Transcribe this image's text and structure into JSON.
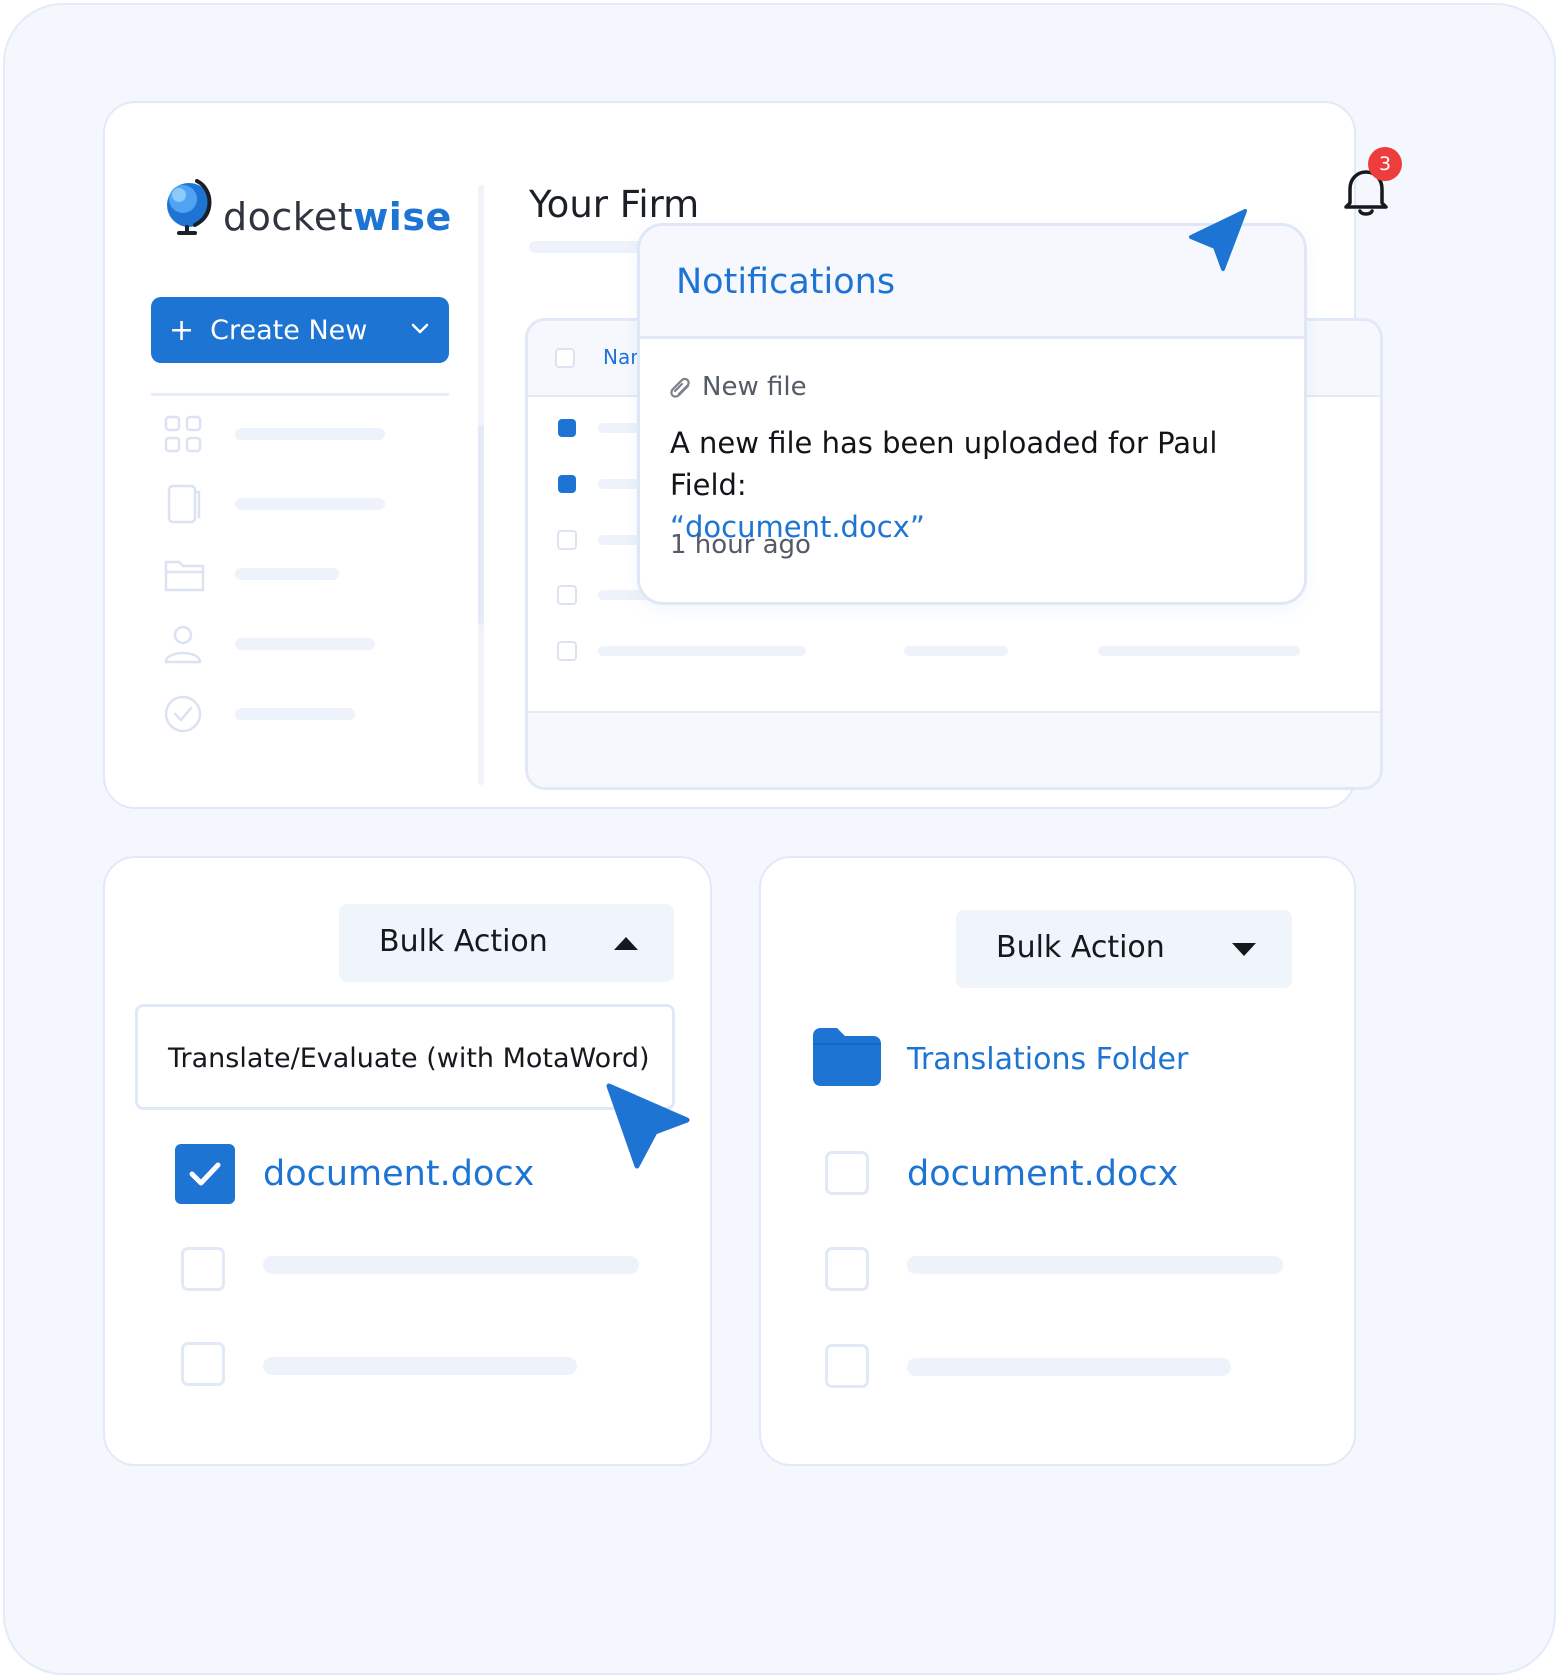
{
  "brand": {
    "logo_prefix": "docket",
    "logo_suffix": "wise"
  },
  "sidebar": {
    "create_button_label": "Create New"
  },
  "header": {
    "page_title": "Your Firm",
    "notification_count": "3"
  },
  "table": {
    "column_name": "Name"
  },
  "notifications": {
    "title": "Notifications",
    "item_type": "New file",
    "message": "A new file has been uploaded for Paul Field:",
    "file_link": "“document.docx”",
    "time": "1 hour ago"
  },
  "bulk_left": {
    "label": "Bulk Action",
    "menu_option": "Translate/Evaluate (with MotaWord)",
    "document": "document.docx"
  },
  "bulk_right": {
    "label": "Bulk Action",
    "folder": "Translations Folder",
    "document": "document.docx"
  },
  "colors": {
    "accent": "#1e74d3",
    "badge": "#ee3d3d",
    "frame": "#f4f7fd"
  }
}
